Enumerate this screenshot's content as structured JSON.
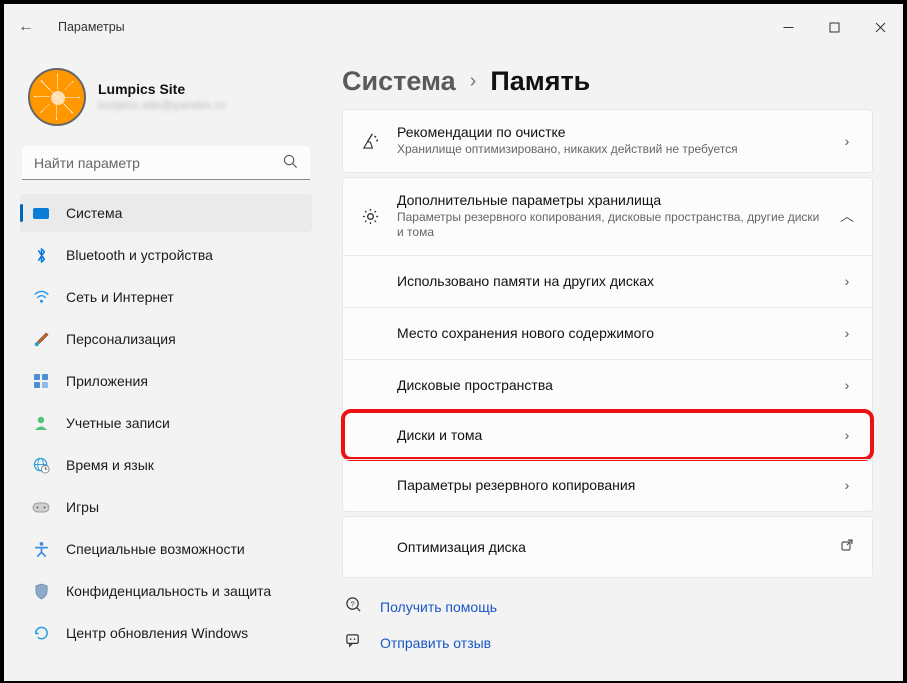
{
  "window": {
    "app_title": "Параметры"
  },
  "profile": {
    "name": "Lumpics Site",
    "email": "lumpics.site@yandex.ru"
  },
  "search": {
    "placeholder": "Найти параметр"
  },
  "sidebar": {
    "items": [
      {
        "label": "Система"
      },
      {
        "label": "Bluetooth и устройства"
      },
      {
        "label": "Сеть и Интернет"
      },
      {
        "label": "Персонализация"
      },
      {
        "label": "Приложения"
      },
      {
        "label": "Учетные записи"
      },
      {
        "label": "Время и язык"
      },
      {
        "label": "Игры"
      },
      {
        "label": "Специальные возможности"
      },
      {
        "label": "Конфиденциальность и защита"
      },
      {
        "label": "Центр обновления Windows"
      }
    ]
  },
  "breadcrumb": {
    "parent": "Система",
    "current": "Память"
  },
  "cards": {
    "cleanup": {
      "title": "Рекомендации по очистке",
      "sub": "Хранилище оптимизировано, никаких действий не требуется"
    },
    "advanced": {
      "title": "Дополнительные параметры хранилища",
      "sub": "Параметры резервного копирования, дисковые пространства, другие диски и тома"
    },
    "rows": [
      "Использовано памяти на других дисках",
      "Место сохранения нового содержимого",
      "Дисковые пространства",
      "Диски и тома",
      "Параметры резервного копирования"
    ],
    "optimize": "Оптимизация диска"
  },
  "links": {
    "help": "Получить помощь",
    "feedback": "Отправить отзыв"
  }
}
